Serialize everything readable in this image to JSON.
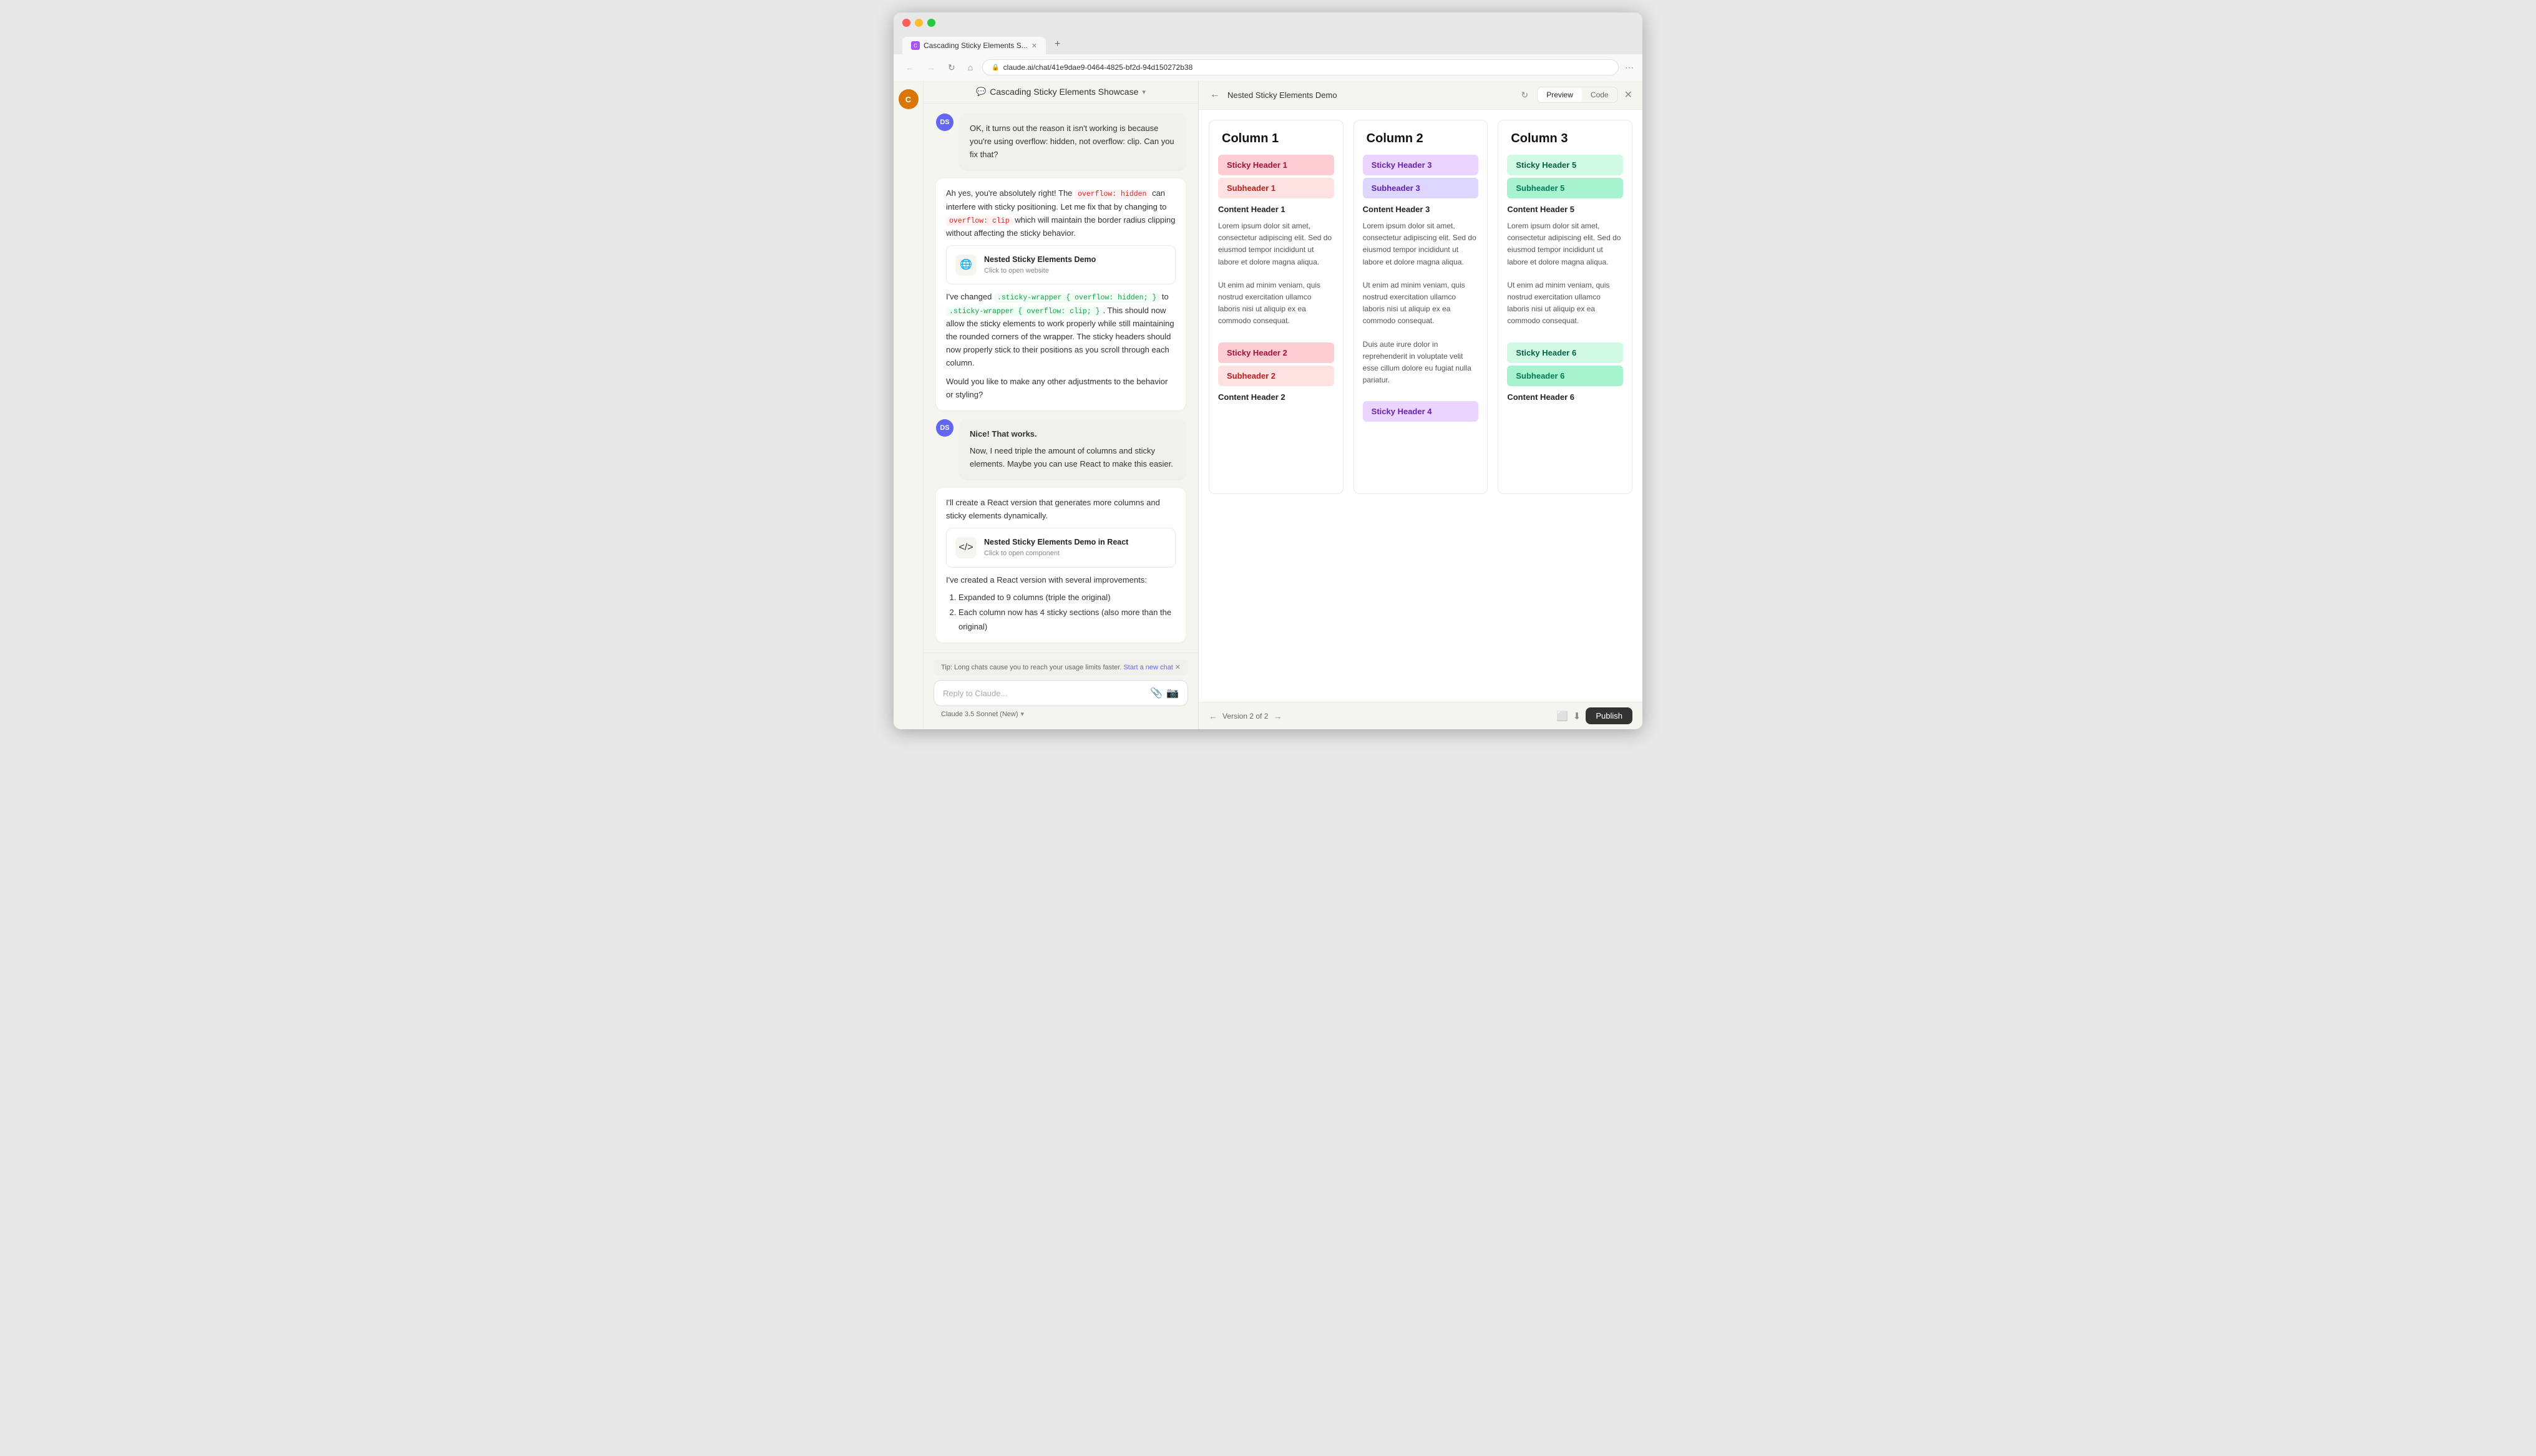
{
  "browser": {
    "tab_title": "Cascading Sticky Elements S...",
    "url": "claude.ai/chat/41e9dae9-0464-4825-bf2d-94d150272b38",
    "new_tab_label": "+"
  },
  "claude": {
    "app_title": "Claude",
    "chat_title": "Cascading Sticky Elements Showcase",
    "chat_title_chevron": "▾"
  },
  "messages": [
    {
      "id": "m1",
      "sender": "assistant",
      "text_parts": [
        {
          "type": "text",
          "content": "OK, it turns out the reason it isn't working is because you're using overflow: hidden, not overflow: clip. Can you fix that?"
        }
      ]
    },
    {
      "id": "m2",
      "sender": "assistant",
      "text_parts": [
        {
          "type": "text",
          "content": "Ah yes, you're absolutely right! The "
        },
        {
          "type": "code_red",
          "content": "overflow: hidden"
        },
        {
          "type": "text",
          "content": " can interfere with sticky positioning. Let me fix that by changing to "
        },
        {
          "type": "code_red",
          "content": "overflow: clip"
        },
        {
          "type": "text",
          "content": " which will maintain the border radius clipping without affecting the sticky behavior."
        }
      ],
      "artifact": {
        "icon": "globe",
        "title": "Nested Sticky Elements Demo",
        "subtitle": "Click to open website"
      },
      "followup_parts": [
        {
          "type": "text",
          "content": "I've changed "
        },
        {
          "type": "code_green",
          "content": ".sticky-wrapper { overflow: hidden; }"
        },
        {
          "type": "text",
          "content": " to "
        },
        {
          "type": "code_green",
          "content": ".sticky-wrapper { overflow: clip; }"
        },
        {
          "type": "text",
          "content": ". This should now allow the sticky elements to work properly while still maintaining the rounded corners of the wrapper. The sticky headers should now properly stick to their positions as you scroll through each column."
        },
        {
          "type": "text",
          "content": "\n\nWould you like to make any other adjustments to the behavior or styling?"
        }
      ]
    },
    {
      "id": "m3",
      "sender": "user",
      "avatar": "DS",
      "text": "Nice! That works.\n\nNow, I need triple the amount of columns and sticky elements. Maybe you can use React to make this easier."
    },
    {
      "id": "m4",
      "sender": "assistant",
      "text": "I'll create a React version that generates more columns and sticky elements dynamically.",
      "artifact": {
        "icon": "code",
        "title": "Nested Sticky Elements Demo in React",
        "subtitle": "Click to open component"
      },
      "followup_parts": [
        {
          "type": "text",
          "content": "I've created a React version with several improvements:"
        },
        {
          "type": "list",
          "items": [
            "Expanded to 9 columns (triple the original)",
            "Each column now has 4 sticky sections (also more than the original)"
          ]
        }
      ]
    }
  ],
  "tip": {
    "text": "Tip: Long chats cause you to reach your usage limits faster.",
    "link_text": "Start a new chat"
  },
  "input": {
    "placeholder": "Reply to Claude...",
    "model": "Claude 3.5 Sonnet (New)"
  },
  "preview": {
    "title": "Nested Sticky Elements Demo",
    "tabs": [
      "Preview",
      "Code"
    ],
    "active_tab": "Preview",
    "version": "Version 2 of 2",
    "publish_label": "Publish",
    "columns": [
      {
        "title": "Column 1",
        "sections": [
          {
            "sticky_header": "Sticky Header 1",
            "sticky_color": "pink",
            "subheader": "Subheader 1",
            "subheader_color": "pink-light",
            "content_header": "Content Header 1",
            "content_text": "Lorem ipsum dolor sit amet, consectetur adipiscing elit. Sed do eiusmod tempor incididunt ut labore et dolore magna aliqua.\n\nUt enim ad minim veniam, quis nostrud exercitation ullamco laboris nisi ut aliquip ex ea commodo consequat."
          },
          {
            "sticky_header": "Sticky Header 2",
            "sticky_color": "pink",
            "subheader": "Subheader 2",
            "subheader_color": "pink-light",
            "content_header": "Content Header 2",
            "content_text": ""
          }
        ]
      },
      {
        "title": "Column 2",
        "sections": [
          {
            "sticky_header": "Sticky Header 3",
            "sticky_color": "purple-light",
            "subheader": "Subheader 3",
            "subheader_color": "purple-medium",
            "content_header": "Content Header 3",
            "content_text": "Lorem ipsum dolor sit amet, consectetur adipiscing elit. Sed do eiusmod tempor incididunt ut labore et dolore magna aliqua.\n\nUt enim ad minim veniam, quis nostrud exercitation ullamco laboris nisi ut aliquip ex ea commodo consequat.\n\nDuis aute irure dolor in reprehenderit in voluptate velit esse cillum dolore eu fugiat nulla pariatur."
          },
          {
            "sticky_header": "Sticky Header 4",
            "sticky_color": "purple-light",
            "subheader": "",
            "content_header": "",
            "content_text": ""
          }
        ]
      },
      {
        "title": "Column 3",
        "sections": [
          {
            "sticky_header": "Sticky Header 5",
            "sticky_color": "green-light",
            "subheader": "Subheader 5",
            "subheader_color": "green-medium",
            "content_header": "Content Header 5",
            "content_text": "Lorem ipsum dolor sit amet, consectetur adipiscing elit. Sed do eiusmod tempor incididunt ut labore et dolore magna aliqua.\n\nUt enim ad minim veniam, quis nostrud exercitation ullamco laboris nisi ut aliquip ex ea commodo consequat."
          },
          {
            "sticky_header": "Sticky Header 6",
            "sticky_color": "green-light",
            "subheader": "Subheader 6",
            "subheader_color": "green-medium",
            "content_header": "Content Header 6",
            "content_text": ""
          }
        ]
      }
    ]
  }
}
